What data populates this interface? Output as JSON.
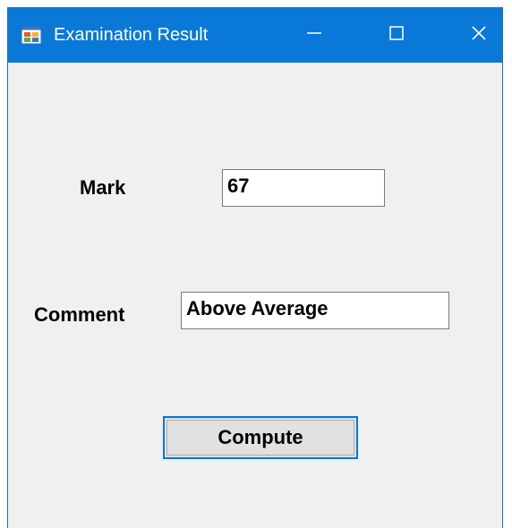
{
  "window": {
    "title": "Examination Result",
    "controls": {
      "minimize_icon": "minimize-icon",
      "maximize_icon": "maximize-icon",
      "close_icon": "close-icon"
    },
    "accent_color": "#0a78d7"
  },
  "form": {
    "mark_label": "Mark",
    "mark_value": "67",
    "comment_label": "Comment",
    "comment_value": "Above Average",
    "compute_label": "Compute"
  }
}
